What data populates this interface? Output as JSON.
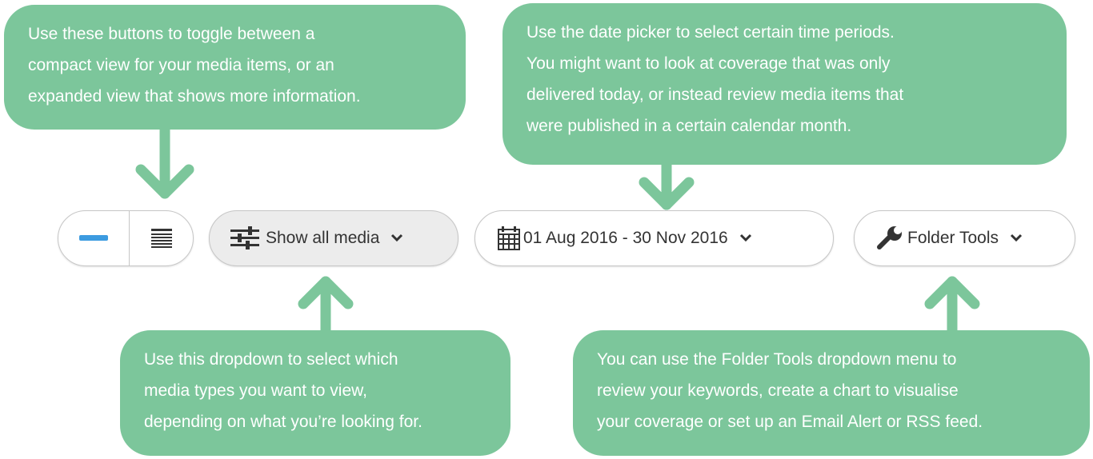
{
  "colors": {
    "callout_bg": "#7cc69b",
    "callout_text": "#ffffff",
    "compact_accent": "#3c9be0",
    "pill_border": "#c6c6c6",
    "pill_fill": "#ffffff",
    "pill_active_fill": "#ececec",
    "text_dark": "#333333"
  },
  "callouts": {
    "view_toggle": {
      "lines": [
        "Use these buttons to toggle between a",
        "compact view for your media items, or an",
        "expanded view that shows more information."
      ]
    },
    "date_picker": {
      "lines": [
        "Use the date picker to select certain time periods.",
        "You might want to look at coverage that was only",
        "delivered today, or instead review media items that",
        "were published in a certain calendar month."
      ]
    },
    "media_filter": {
      "lines": [
        "Use this dropdown to select which",
        "media types you want to view,",
        "depending on what you’re looking for."
      ]
    },
    "folder_tools": {
      "lines": [
        "You can use the Folder Tools dropdown menu to",
        "review your keywords, create a chart to visualise",
        "your coverage or set up an Email Alert or RSS feed."
      ]
    }
  },
  "toolbar": {
    "view_toggle": {
      "compact_icon": "minus-icon",
      "expanded_icon": "list-lines-icon"
    },
    "media_filter": {
      "icon": "sliders-icon",
      "label": "Show all media",
      "chevron": "chevron-down-icon"
    },
    "date_range": {
      "icon": "calendar-icon",
      "label": "01 Aug 2016 - 30 Nov 2016",
      "chevron": "chevron-down-icon"
    },
    "folder_tools": {
      "icon": "wrench-icon",
      "label": "Folder Tools",
      "chevron": "chevron-down-icon"
    }
  }
}
